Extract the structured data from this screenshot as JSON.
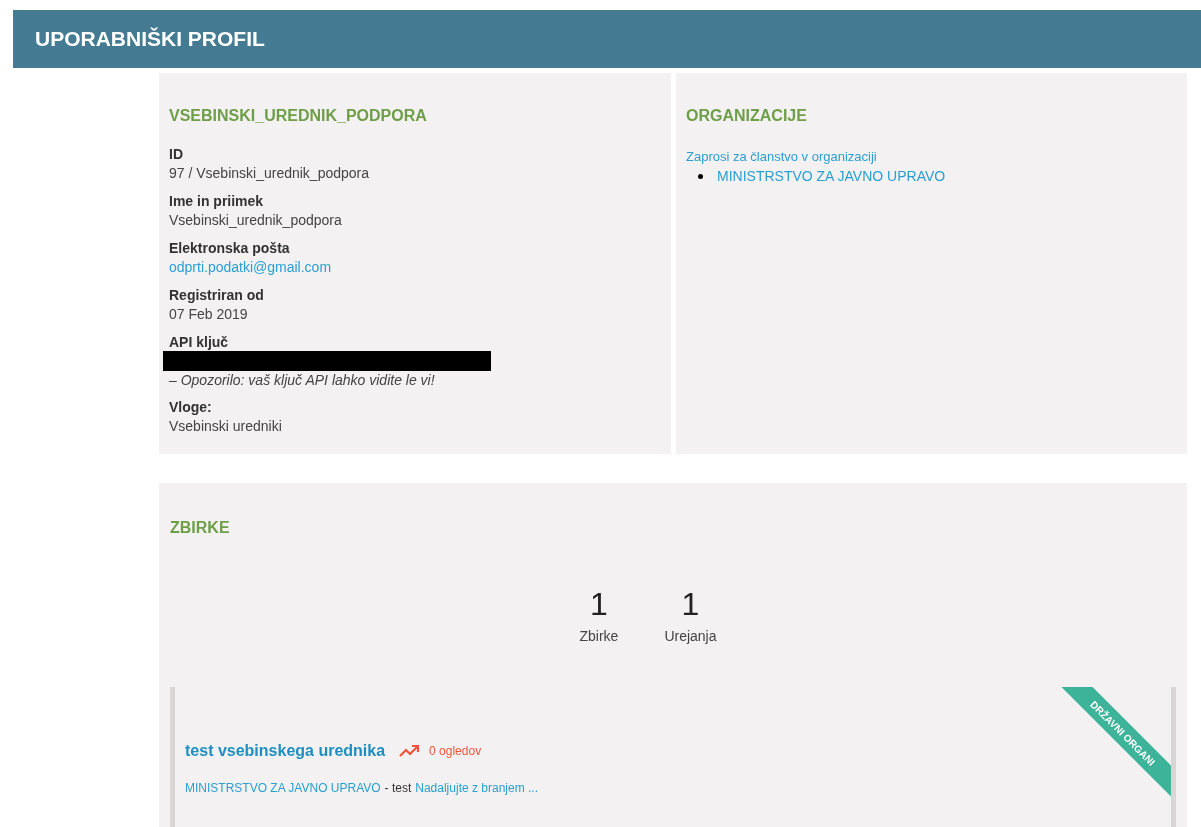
{
  "page_title": "UPORABNIŠKI PROFIL",
  "profile": {
    "heading": "VSEBINSKI_UREDNIK_PODPORA",
    "fields": [
      {
        "kind": "text",
        "label": "ID",
        "value": "97 / Vsebinski_urednik_podpora"
      },
      {
        "kind": "text",
        "label": "Ime in priimek",
        "value": "Vsebinski_urednik_podpora"
      },
      {
        "kind": "link",
        "label": "Elektronska pošta",
        "value": "odprti.podatki@gmail.com"
      },
      {
        "kind": "text",
        "label": "Registriran od",
        "value": "07 Feb 2019"
      },
      {
        "kind": "hidden",
        "label": "API ključ",
        "note": "– Opozorilo: vaš ključ API lahko vidite le vi!"
      },
      {
        "kind": "text",
        "label": "Vloge:",
        "value": "Vsebinski uredniki"
      }
    ]
  },
  "organizations": {
    "heading": "ORGANIZACIJE",
    "request_link": "Zaprosi za članstvo v organizaciji",
    "items": [
      "MINISTRSTVO ZA JAVNO UPRAVO"
    ]
  },
  "collections": {
    "heading": "ZBIRKE",
    "stats": [
      {
        "value": "1",
        "label": "Zbirke"
      },
      {
        "value": "1",
        "label": "Urejanja"
      }
    ],
    "items": [
      {
        "title": "test vsebinskega urednika",
        "views": "0 ogledov",
        "organization": "MINISTRSTVO ZA JAVNO UPRAVO",
        "separator": "- test",
        "read_more": "Nadaljujte z branjem ...",
        "ribbon": "DRŽAVNI ORGANI"
      }
    ]
  }
}
